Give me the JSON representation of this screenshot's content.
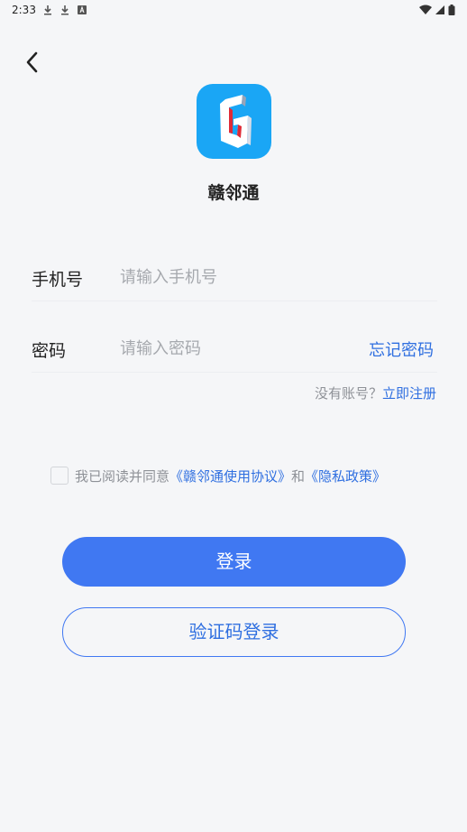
{
  "status_bar": {
    "time": "2:33",
    "left_icons": [
      "download-icon",
      "download-icon",
      "notification-a-icon"
    ],
    "right_icons": [
      "wifi-icon",
      "signal-icon",
      "battery-icon"
    ]
  },
  "header": {
    "back_icon": "chevron-left-icon"
  },
  "app": {
    "name": "赣邻通",
    "logo_color": "#1aa6f5"
  },
  "form": {
    "phone": {
      "label": "手机号",
      "placeholder": "请输入手机号",
      "value": ""
    },
    "password": {
      "label": "密码",
      "placeholder": "请输入密码",
      "value": ""
    },
    "forgot_label": "忘记密码"
  },
  "register": {
    "prompt": "没有账号？",
    "link": "立即注册"
  },
  "agreement": {
    "checked": false,
    "prefix": "我已阅读并同意",
    "terms": "《赣邻通使用协议》",
    "and": "和",
    "privacy": "《隐私政策》"
  },
  "buttons": {
    "login": "登录",
    "sms_login": "验证码登录"
  },
  "colors": {
    "accent": "#4078f2",
    "link": "#2f6fe0",
    "background": "#f5f6f8"
  }
}
